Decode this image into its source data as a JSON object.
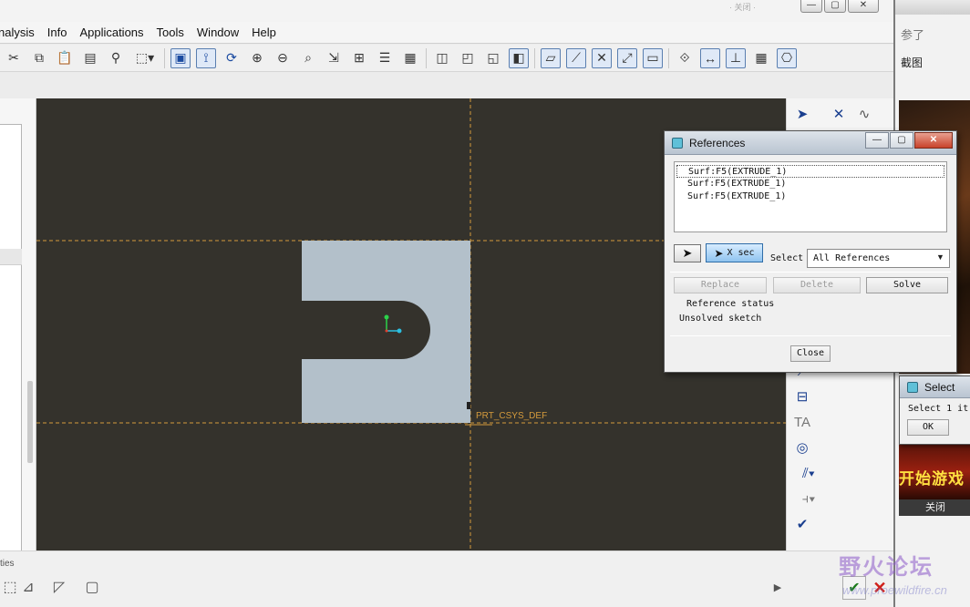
{
  "titlebar": {
    "blurred_text": "· 关闭 ·"
  },
  "menu": {
    "items": [
      "nalysis",
      "Info",
      "Applications",
      "Tools",
      "Window",
      "Help"
    ]
  },
  "viewport": {
    "csys_label": "PRT_CSYS_DEF",
    "colors": {
      "background": "#34322c",
      "part": "#b3c0ca",
      "datum_line": "#d49a3c"
    }
  },
  "references_dialog": {
    "title": "References",
    "references": [
      "Surf:F5(EXTRUDE_1)",
      "Surf:F5(EXTRUDE_1)",
      "Surf:F5(EXTRUDE_1)"
    ],
    "xsec_label": "X sec",
    "select_label": "Select",
    "select_value": "All References",
    "replace_label": "Replace",
    "delete_label": "Delete",
    "solve_label": "Solve",
    "status_heading": "Reference status",
    "status_value": "Unsolved sketch",
    "close_label": "Close"
  },
  "select_dialog": {
    "title": "Select",
    "text": "Select 1 it",
    "ok_label": "OK"
  },
  "bottom": {
    "label": "ties"
  },
  "right_window": {
    "text1": "参了",
    "text2": "截图",
    "ad_text": "开始游戏",
    "close_text": "关闭"
  },
  "watermark": {
    "text": "野火论坛",
    "url": "www.proewildfire.cn"
  }
}
